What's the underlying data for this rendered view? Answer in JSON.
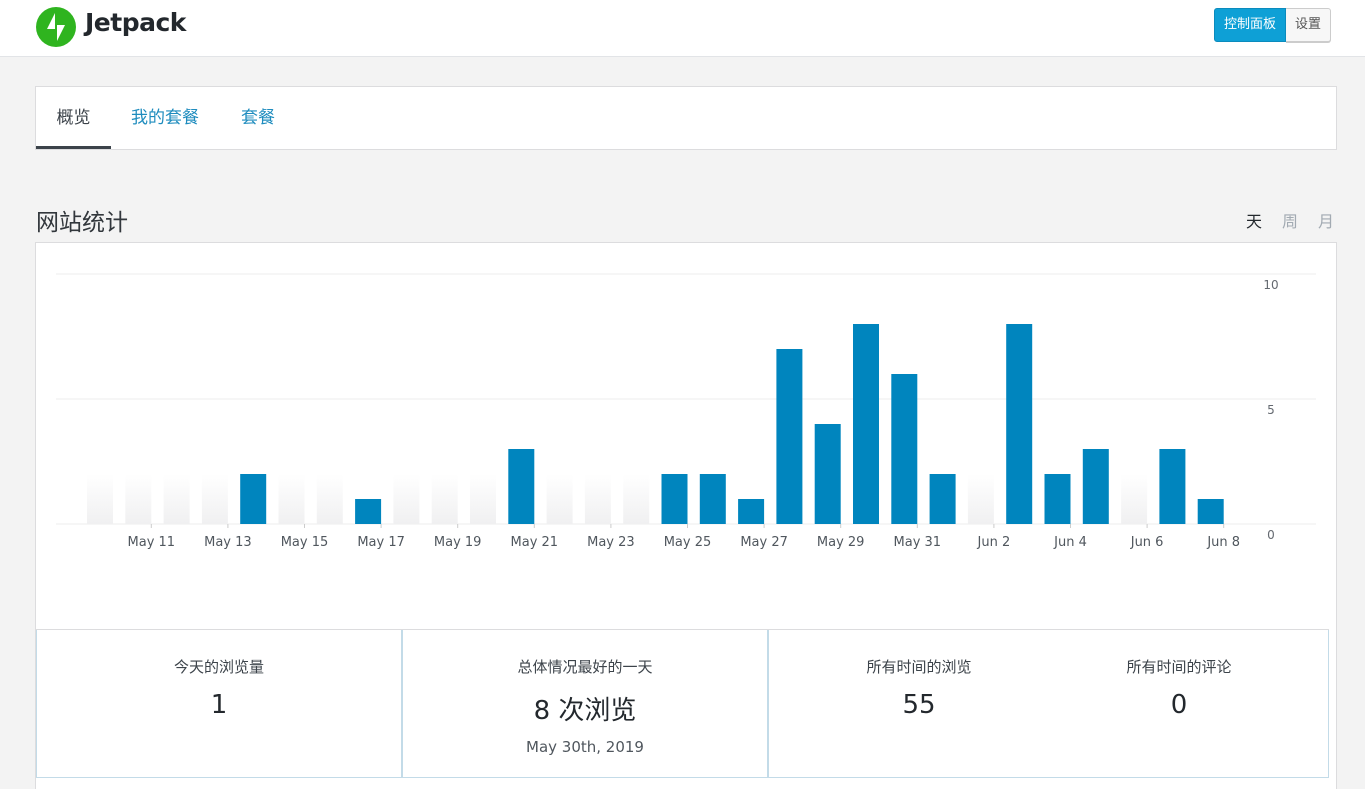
{
  "header": {
    "logo_text": "Jetpack",
    "dashboard_button": "控制面板",
    "settings_button": "设置",
    "accent_color": "#0ea0d6",
    "logo_color": "#2fb41f"
  },
  "nav": {
    "tabs": [
      {
        "label": "概览",
        "active": true
      },
      {
        "label": "我的套餐",
        "active": false
      },
      {
        "label": "套餐",
        "active": false
      }
    ]
  },
  "stats_section": {
    "title": "网站统计",
    "periods": [
      {
        "label": "天",
        "active": true
      },
      {
        "label": "周",
        "active": false
      },
      {
        "label": "月",
        "active": false
      }
    ]
  },
  "chart_data": {
    "type": "bar",
    "categories": [
      "May 10",
      "May 11",
      "May 12",
      "May 13",
      "May 14",
      "May 15",
      "May 16",
      "May 17",
      "May 18",
      "May 19",
      "May 20",
      "May 21",
      "May 22",
      "May 23",
      "May 24",
      "May 25",
      "May 26",
      "May 27",
      "May 28",
      "May 29",
      "May 30",
      "May 31",
      "Jun 1",
      "Jun 2",
      "Jun 3",
      "Jun 4",
      "Jun 5",
      "Jun 6",
      "Jun 7",
      "Jun 8"
    ],
    "values": [
      0,
      0,
      0,
      0,
      2,
      0,
      0,
      1,
      0,
      0,
      0,
      3,
      0,
      0,
      0,
      2,
      2,
      1,
      7,
      4,
      8,
      6,
      2,
      0,
      8,
      2,
      3,
      0,
      3,
      1
    ],
    "x_tick_labels": [
      "May 11",
      "May 13",
      "May 15",
      "May 17",
      "May 19",
      "May 21",
      "May 23",
      "May 25",
      "May 27",
      "May 29",
      "May 31",
      "Jun 2",
      "Jun 4",
      "Jun 6",
      "Jun 8"
    ],
    "y_tick_labels": [
      "10",
      "5",
      "0"
    ],
    "ylim": [
      0,
      10
    ],
    "bar_color": "#0085be",
    "grid": true
  },
  "stats": {
    "today_label": "今天的浏览量",
    "today_value": "1",
    "best_day_label": "总体情况最好的一天",
    "best_day_value": "8 次浏览",
    "best_day_date": "May 30th, 2019",
    "all_time_views_label": "所有时间的浏览",
    "all_time_views_value": "55",
    "all_time_comments_label": "所有时间的评论",
    "all_time_comments_value": "0"
  }
}
